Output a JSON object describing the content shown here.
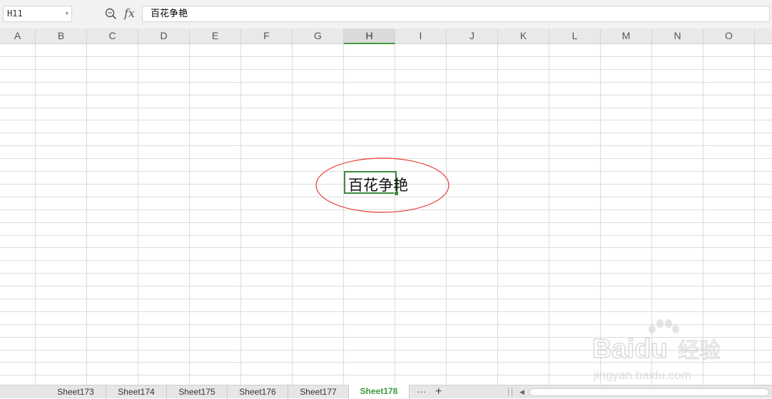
{
  "formula_bar": {
    "cell_ref": "H11",
    "fx_label": "fx",
    "formula_value": "百花争艳"
  },
  "columns": [
    "A",
    "B",
    "C",
    "D",
    "E",
    "F",
    "G",
    "H",
    "I",
    "J",
    "K",
    "L",
    "M",
    "N",
    "O"
  ],
  "active_column": "H",
  "cell": {
    "text": "百花争艳"
  },
  "sheet_tabs": [
    "Sheet173",
    "Sheet174",
    "Sheet175",
    "Sheet176",
    "Sheet177",
    "Sheet178"
  ],
  "active_sheet": "Sheet178",
  "tab_controls": {
    "more": "···",
    "add": "+"
  },
  "watermark": {
    "brand": "Baidu",
    "brand_cn": "经验",
    "url": "jingyan.baidu.com"
  },
  "colors": {
    "selection": "#3d8c3d",
    "annotation": "#e53935",
    "active_tab_text": "#3b9a3b"
  }
}
